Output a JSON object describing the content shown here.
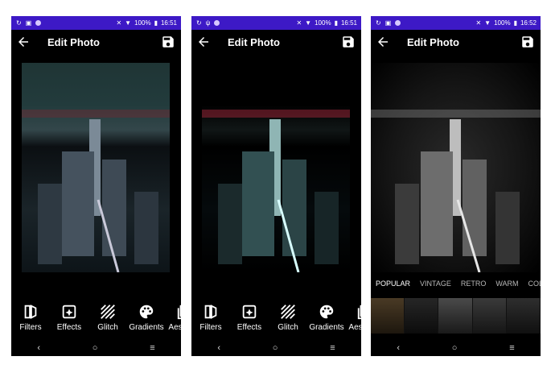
{
  "screens": [
    {
      "status": {
        "battery": "100%",
        "time": "16:51"
      },
      "appbar": {
        "title": "Edit Photo"
      },
      "tools": [
        {
          "label": "Filters",
          "icon": "filters-icon"
        },
        {
          "label": "Effects",
          "icon": "effects-icon"
        },
        {
          "label": "Glitch",
          "icon": "glitch-icon"
        },
        {
          "label": "Gradients",
          "icon": "gradients-icon"
        },
        {
          "label": "Aesthetic",
          "icon": "aesthetic-icon"
        }
      ],
      "nav": {
        "back": "‹",
        "home": "○",
        "recents": "≡"
      }
    },
    {
      "status": {
        "battery": "100%",
        "time": "16:51"
      },
      "appbar": {
        "title": "Edit Photo"
      },
      "tools": [
        {
          "label": "Filters",
          "icon": "filters-icon"
        },
        {
          "label": "Effects",
          "icon": "effects-icon"
        },
        {
          "label": "Glitch",
          "icon": "glitch-icon"
        },
        {
          "label": "Gradients",
          "icon": "gradients-icon"
        },
        {
          "label": "Aesthetic",
          "icon": "aesthetic-icon"
        }
      ],
      "nav": {
        "back": "‹",
        "home": "○",
        "recents": "≡"
      }
    },
    {
      "status": {
        "battery": "100%",
        "time": "16:52"
      },
      "appbar": {
        "title": "Edit Photo"
      },
      "filter_tabs": [
        "POPULAR",
        "VINTAGE",
        "RETRO",
        "WARM",
        "COLD"
      ],
      "active_tab": "POPULAR",
      "nav": {
        "back": "‹",
        "home": "○",
        "recents": "≡"
      }
    }
  ]
}
